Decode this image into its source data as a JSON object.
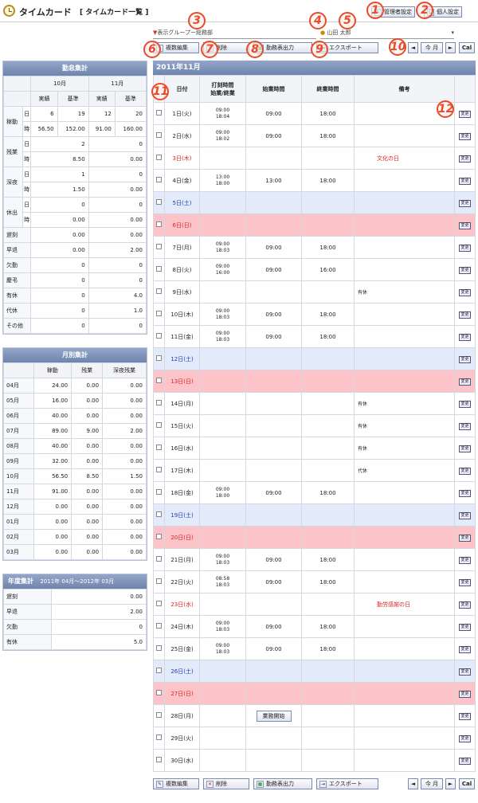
{
  "header": {
    "title": "タイムカード",
    "subtitle": "[ タイムカード一覧 ]",
    "admin": "管理者設定",
    "personal": "個人設定"
  },
  "filters": {
    "group": "表示グループー総務部",
    "user": "山田 太郎"
  },
  "toolbar": {
    "bulk_edit": "複数編集",
    "delete": "削除",
    "print": "勤務表出力",
    "export": "エクスポート"
  },
  "nav": {
    "prev": "◄",
    "month": "今 月",
    "next": "►",
    "cal": "Cal"
  },
  "numbers": [
    "1",
    "2",
    "3",
    "4",
    "5",
    "6",
    "7",
    "8",
    "9",
    "10",
    "11",
    "12"
  ],
  "attendance": {
    "title": "勤怠集計",
    "months": [
      "10月",
      "11月"
    ],
    "sub": [
      "実績",
      "基準",
      "実績",
      "基準"
    ],
    "rows": [
      {
        "g": "稼動",
        "u": "日",
        "v": [
          "6",
          "19",
          "12",
          "20"
        ]
      },
      {
        "g": "",
        "u": "時",
        "v": [
          "56.50",
          "152.00",
          "91.00",
          "160.00"
        ]
      },
      {
        "g": "残業",
        "u": "日",
        "v": [
          "2",
          "0"
        ]
      },
      {
        "g": "",
        "u": "時",
        "v": [
          "8.50",
          "0.00"
        ]
      },
      {
        "g": "深夜",
        "u": "日",
        "v": [
          "1",
          "0"
        ]
      },
      {
        "g": "",
        "u": "時",
        "v": [
          "1.50",
          "0.00"
        ]
      },
      {
        "g": "休出",
        "u": "日",
        "v": [
          "0",
          "0"
        ]
      },
      {
        "g": "",
        "u": "時",
        "v": [
          "0.00",
          "0.00"
        ]
      },
      {
        "g": "遅刻",
        "u": "",
        "v": [
          "0.00",
          "0.00"
        ]
      },
      {
        "g": "早退",
        "u": "",
        "v": [
          "0.00",
          "2.00"
        ]
      },
      {
        "g": "欠勤",
        "u": "",
        "v": [
          "0",
          "0"
        ]
      },
      {
        "g": "慶弔",
        "u": "",
        "v": [
          "0",
          "0"
        ]
      },
      {
        "g": "有休",
        "u": "",
        "v": [
          "0",
          "4.0"
        ]
      },
      {
        "g": "代休",
        "u": "",
        "v": [
          "0",
          "1.0"
        ]
      },
      {
        "g": "その他",
        "u": "",
        "v": [
          "0",
          "0"
        ]
      }
    ]
  },
  "monthly": {
    "title": "月別集計",
    "headers": [
      "稼動",
      "残業",
      "深夜残業"
    ],
    "rows": [
      [
        "04月",
        "24.00",
        "0.00",
        "0.00"
      ],
      [
        "05月",
        "16.00",
        "0.00",
        "0.00"
      ],
      [
        "06月",
        "40.00",
        "0.00",
        "0.00"
      ],
      [
        "07月",
        "89.00",
        "9.00",
        "2.00"
      ],
      [
        "08月",
        "40.00",
        "0.00",
        "0.00"
      ],
      [
        "09月",
        "32.00",
        "0.00",
        "0.00"
      ],
      [
        "10月",
        "56.50",
        "8.50",
        "1.50"
      ],
      [
        "11月",
        "91.00",
        "0.00",
        "0.00"
      ],
      [
        "12月",
        "0.00",
        "0.00",
        "0.00"
      ],
      [
        "01月",
        "0.00",
        "0.00",
        "0.00"
      ],
      [
        "02月",
        "0.00",
        "0.00",
        "0.00"
      ],
      [
        "03月",
        "0.00",
        "0.00",
        "0.00"
      ]
    ]
  },
  "yearly": {
    "title": "年度集計",
    "range": "2011年 04月〜2012年 03月",
    "rows": [
      [
        "遅刻",
        "0.00"
      ],
      [
        "早退",
        "2.00"
      ],
      [
        "欠勤",
        "0"
      ],
      [
        "有休",
        "5.0"
      ]
    ]
  },
  "main": {
    "month_title": "2011年11月",
    "headers": [
      "日付",
      "打刻時間\n始業/終業",
      "始業時間",
      "終業時間",
      "備考"
    ],
    "change": "変更",
    "start_work": "業務開始",
    "days": [
      {
        "d": "1日(火)",
        "t": "n",
        "p": "09:00|18:04",
        "s": "09:00",
        "e": "18:00",
        "n": ""
      },
      {
        "d": "2日(水)",
        "t": "n",
        "p": "09:00|18:02",
        "s": "09:00",
        "e": "18:00",
        "n": ""
      },
      {
        "d": "3日(木)",
        "t": "h",
        "p": "",
        "s": "",
        "e": "",
        "n": "文化の日"
      },
      {
        "d": "4日(金)",
        "t": "n",
        "p": "13:00|18:00",
        "s": "13:00",
        "e": "18:00",
        "n": ""
      },
      {
        "d": "5日(土)",
        "t": "sat",
        "p": "",
        "s": "",
        "e": "",
        "n": ""
      },
      {
        "d": "6日(日)",
        "t": "sun",
        "p": "",
        "s": "",
        "e": "",
        "n": ""
      },
      {
        "d": "7日(月)",
        "t": "n",
        "p": "09:00|18:03",
        "s": "09:00",
        "e": "18:00",
        "n": ""
      },
      {
        "d": "8日(火)",
        "t": "n",
        "p": "09:00|16:00",
        "s": "09:00",
        "e": "16:00",
        "n": ""
      },
      {
        "d": "9日(水)",
        "t": "n",
        "p": "",
        "s": "",
        "e": "",
        "n": "",
        "k": "有休"
      },
      {
        "d": "10日(木)",
        "t": "n",
        "p": "09:00|18:03",
        "s": "09:00",
        "e": "18:00",
        "n": ""
      },
      {
        "d": "11日(金)",
        "t": "n",
        "p": "09:00|18:03",
        "s": "09:00",
        "e": "18:00",
        "n": ""
      },
      {
        "d": "12日(土)",
        "t": "sat",
        "p": "",
        "s": "",
        "e": "",
        "n": ""
      },
      {
        "d": "13日(日)",
        "t": "sun",
        "p": "",
        "s": "",
        "e": "",
        "n": ""
      },
      {
        "d": "14日(月)",
        "t": "n",
        "p": "",
        "s": "",
        "e": "",
        "n": "",
        "k": "有休"
      },
      {
        "d": "15日(火)",
        "t": "n",
        "p": "",
        "s": "",
        "e": "",
        "n": "",
        "k": "有休"
      },
      {
        "d": "16日(水)",
        "t": "n",
        "p": "",
        "s": "",
        "e": "",
        "n": "",
        "k": "有休"
      },
      {
        "d": "17日(木)",
        "t": "n",
        "p": "",
        "s": "",
        "e": "",
        "n": "",
        "k": "代休"
      },
      {
        "d": "18日(金)",
        "t": "n",
        "p": "09:00|18:00",
        "s": "09:00",
        "e": "18:00",
        "n": ""
      },
      {
        "d": "19日(土)",
        "t": "sat",
        "p": "",
        "s": "",
        "e": "",
        "n": ""
      },
      {
        "d": "20日(日)",
        "t": "sun",
        "p": "",
        "s": "",
        "e": "",
        "n": ""
      },
      {
        "d": "21日(月)",
        "t": "n",
        "p": "09:00|18:03",
        "s": "09:00",
        "e": "18:00",
        "n": ""
      },
      {
        "d": "22日(火)",
        "t": "n",
        "p": "08:58|18:03",
        "s": "09:00",
        "e": "18:00",
        "n": ""
      },
      {
        "d": "23日(水)",
        "t": "h",
        "p": "",
        "s": "",
        "e": "",
        "n": "勤労感謝の日"
      },
      {
        "d": "24日(木)",
        "t": "n",
        "p": "09:00|18:03",
        "s": "09:00",
        "e": "18:00",
        "n": ""
      },
      {
        "d": "25日(金)",
        "t": "n",
        "p": "09:00|18:03",
        "s": "09:00",
        "e": "18:00",
        "n": ""
      },
      {
        "d": "26日(土)",
        "t": "sat",
        "p": "",
        "s": "",
        "e": "",
        "n": ""
      },
      {
        "d": "27日(日)",
        "t": "sun",
        "p": "",
        "s": "",
        "e": "",
        "n": ""
      },
      {
        "d": "28日(月)",
        "t": "n",
        "p": "",
        "s": "",
        "e": "",
        "n": "",
        "b": 1
      },
      {
        "d": "29日(火)",
        "t": "n",
        "p": "",
        "s": "",
        "e": "",
        "n": ""
      },
      {
        "d": "30日(水)",
        "t": "n",
        "p": "",
        "s": "",
        "e": "",
        "n": ""
      }
    ]
  }
}
